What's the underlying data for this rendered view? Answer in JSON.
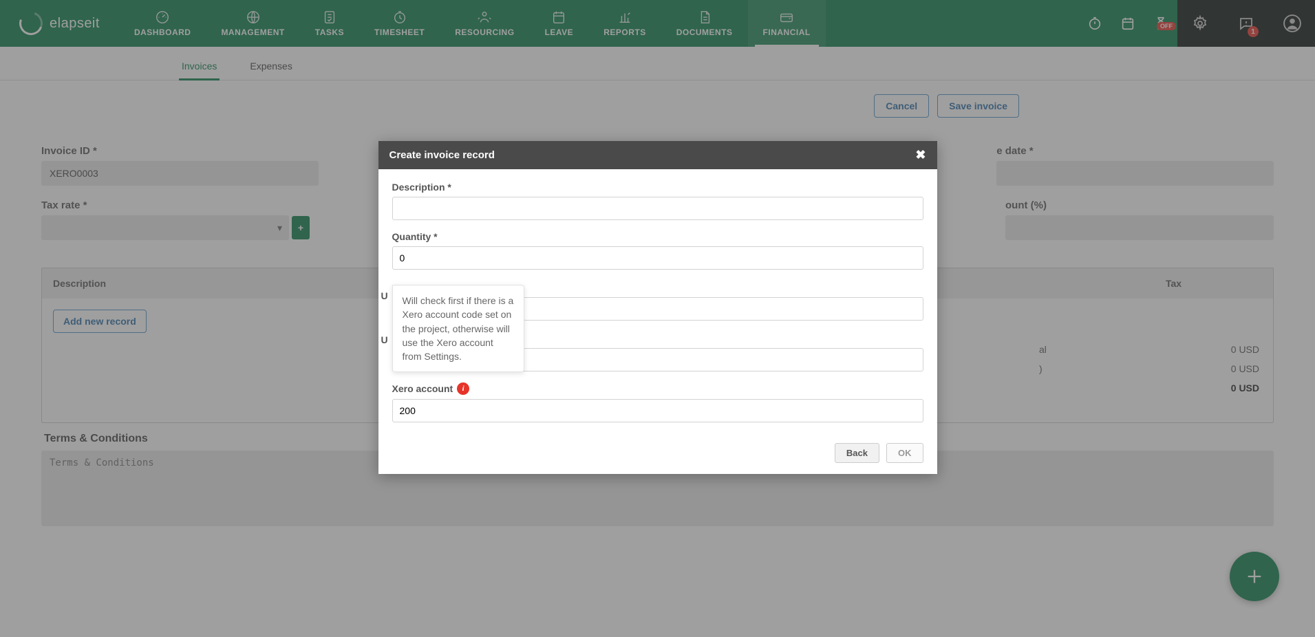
{
  "brand": {
    "name": "elapseit"
  },
  "nav": {
    "items": [
      {
        "label": "DASHBOARD"
      },
      {
        "label": "MANAGEMENT"
      },
      {
        "label": "TASKS"
      },
      {
        "label": "TIMESHEET"
      },
      {
        "label": "RESOURCING"
      },
      {
        "label": "LEAVE"
      },
      {
        "label": "REPORTS"
      },
      {
        "label": "DOCUMENTS"
      },
      {
        "label": "FINANCIAL"
      }
    ],
    "right": {
      "off_badge": "OFF",
      "count_badge": "1"
    }
  },
  "subtabs": {
    "invoices": "Invoices",
    "expenses": "Expenses"
  },
  "actions": {
    "cancel": "Cancel",
    "save": "Save invoice",
    "add_record": "Add new record"
  },
  "form": {
    "invoice_id_label": "Invoice ID *",
    "invoice_id_value": "XERO0003",
    "due_date_label_partial": "e date *",
    "tax_rate_label": "Tax rate *",
    "discount_label_partial": "ount (%)"
  },
  "table": {
    "th_desc": "Description",
    "th_tax": "Tax"
  },
  "totals": {
    "subtotal_label_partial": "al",
    "subtotal_value": "0 USD",
    "tax_label_partial": ")",
    "tax_value": "0 USD",
    "total_value": "0 USD"
  },
  "terms": {
    "heading": "Terms & Conditions",
    "placeholder": "Terms & Conditions"
  },
  "modal": {
    "title": "Create invoice record",
    "desc_label": "Description *",
    "qty_label": "Quantity *",
    "qty_value": "0",
    "u1_partial": "U",
    "u2_partial": "U",
    "xero_label": "Xero account",
    "xero_value": "200",
    "tooltip": "Will check first if there is a Xero account code set on the project, otherwise will use the Xero account from Settings.",
    "back": "Back",
    "ok": "OK"
  }
}
